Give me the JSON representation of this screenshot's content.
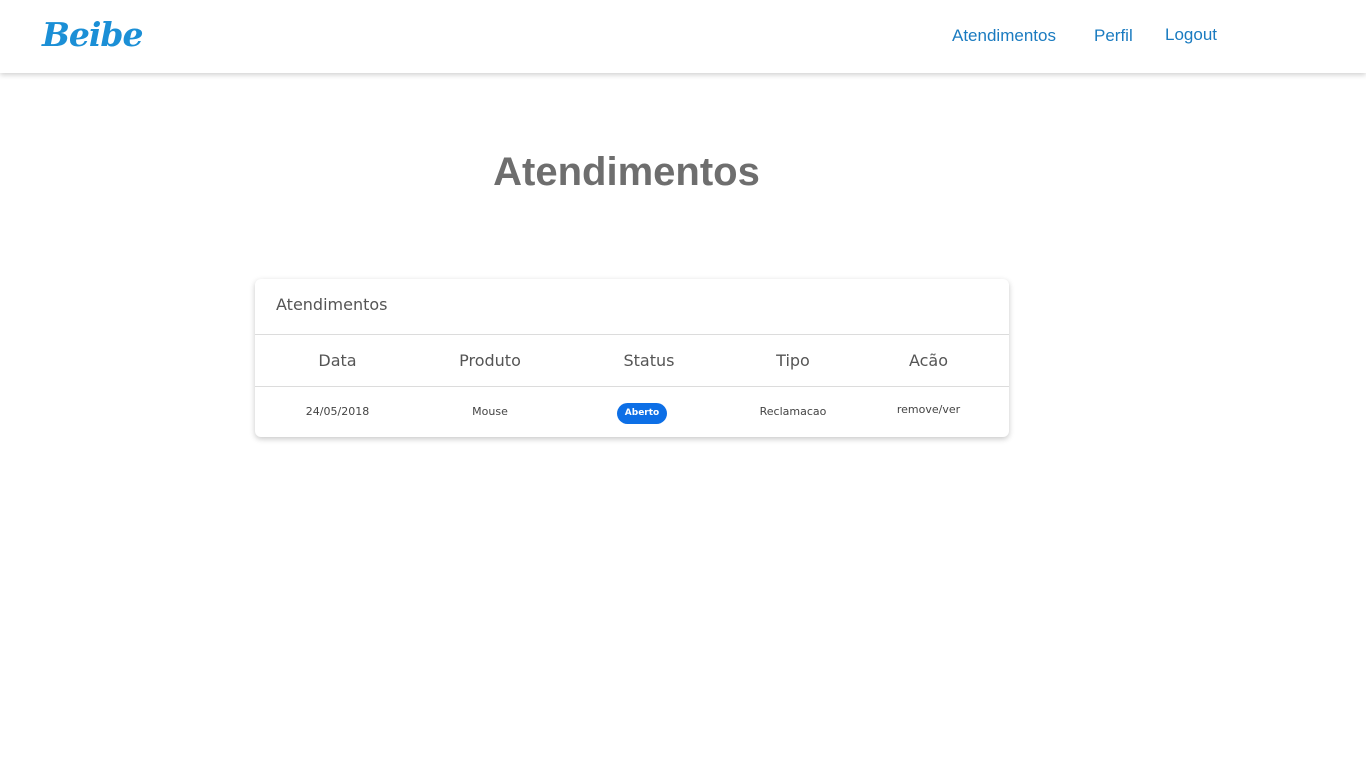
{
  "brand": {
    "logo_text": "Beibe",
    "color": "#1b8fd6"
  },
  "nav": {
    "items": [
      {
        "label": "Atendimentos"
      },
      {
        "label": "Perfil"
      },
      {
        "label": "Logout"
      }
    ],
    "link_color": "#1a7bc0"
  },
  "page": {
    "title": "Atendimentos"
  },
  "table_card": {
    "header": "Atendimentos",
    "columns": [
      "Data",
      "Produto",
      "Status",
      "Tipo",
      "Acão"
    ],
    "rows": [
      {
        "data": "24/05/2018",
        "produto": "Mouse",
        "status": "Aberto",
        "tipo": "Reclamacao",
        "acao": "remove/ver"
      }
    ],
    "status_badge_color": "#0d6fe6"
  }
}
